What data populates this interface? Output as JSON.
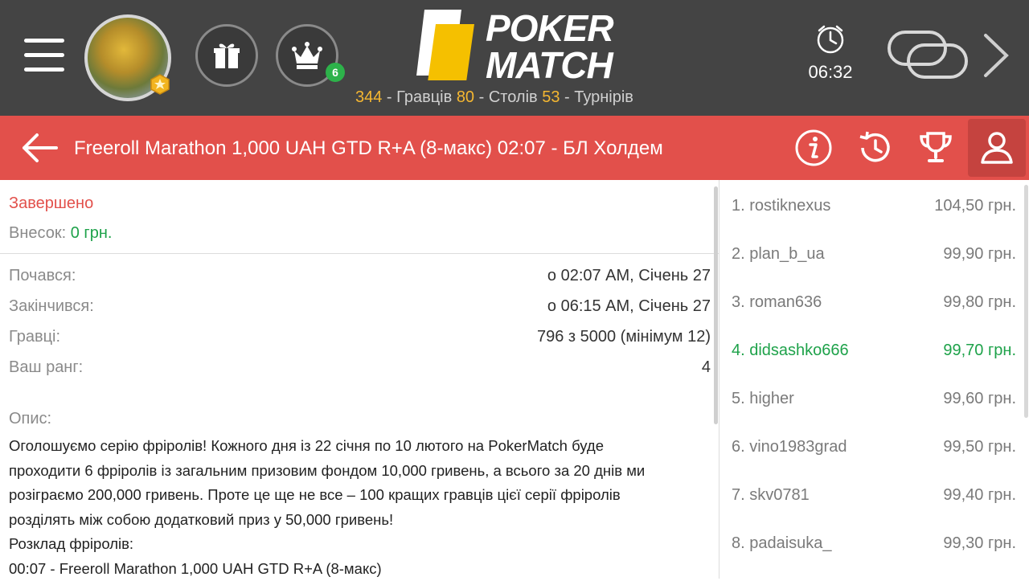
{
  "header": {
    "logo_line1": "POKER",
    "logo_line2": "MATCH",
    "stats": {
      "players_count": "344",
      "players_label": " - Гравців ",
      "tables_count": "80",
      "tables_label": " - Столів ",
      "tournaments_count": "53",
      "tournaments_label": " - Турнірів"
    },
    "crown_badge": "6",
    "clock_time": "06:32"
  },
  "titlebar": {
    "title": "Freeroll Marathon 1,000 UAH GTD R+A (8-макс) 02:07 - БЛ Холдем"
  },
  "tournament": {
    "status": "Завершено",
    "buyin_label": "Внесок: ",
    "buyin_value": "0 грн.",
    "details": [
      {
        "label": "Почався:",
        "value": "о 02:07 AM, Січень 27"
      },
      {
        "label": "Закінчився:",
        "value": "о 06:15 AM, Січень 27"
      },
      {
        "label": "Гравці:",
        "value": "796 з 5000 (мінімум 12)"
      },
      {
        "label": "Ваш ранг:",
        "value": "4"
      }
    ],
    "description_label": "Опис:",
    "description": [
      "Оголошуємо серію фріролів! Кожного дня із 22 січня по 10 лютого на PokerMatch буде",
      "проходити 6 фріролів із загальним призовим фондом 10,000 гривень, а всього за 20 днів ми",
      "розіграємо 200,000 гривень. Проте це ще не все – 100 кращих гравців цієї серії фріролів",
      "розділять між собою додатковий приз у 50,000 гривень!",
      "Розклад фріролів:",
      "00:07 - Freeroll Marathon 1,000 UAH GTD R+A (8-макс)"
    ]
  },
  "results": [
    {
      "rank": "1. rostiknexus",
      "amount": "104,50 грн."
    },
    {
      "rank": "2. plan_b_ua",
      "amount": "99,90 грн."
    },
    {
      "rank": "3. roman636",
      "amount": "99,80 грн."
    },
    {
      "rank": "4. didsashko666",
      "amount": "99,70 грн."
    },
    {
      "rank": "5. higher",
      "amount": "99,60 грн."
    },
    {
      "rank": "6. vino1983grad",
      "amount": "99,50 грн."
    },
    {
      "rank": "7. skv0781",
      "amount": "99,40 грн."
    },
    {
      "rank": "8. padaisuka_",
      "amount": "99,30 грн."
    }
  ],
  "colors": {
    "topbar": "#444444",
    "accent_red": "#e2504b",
    "highlight_green": "#1ea24a",
    "stat_orange": "#f5b731"
  }
}
